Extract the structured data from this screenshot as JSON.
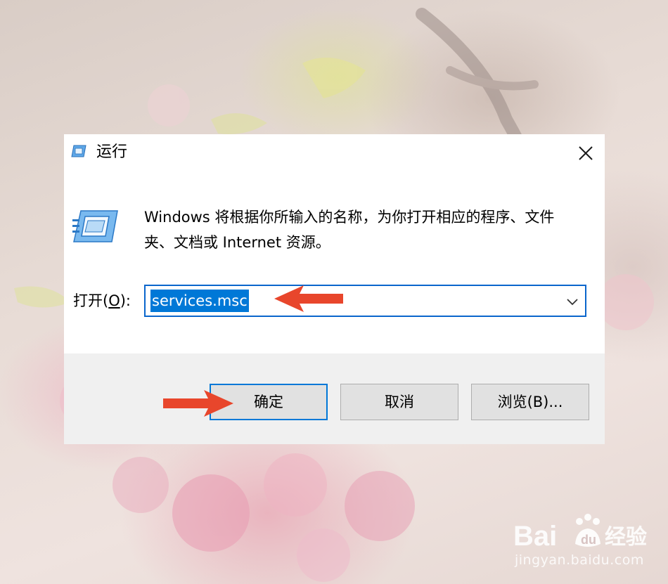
{
  "dialog": {
    "title": "运行",
    "description": "Windows 将根据你所输入的名称，为你打开相应的程序、文件夹、文档或 Internet 资源。",
    "open_label_prefix": "打开(",
    "open_label_key": "O",
    "open_label_suffix": "):",
    "input_value": "services.msc",
    "buttons": {
      "ok": "确定",
      "cancel": "取消",
      "browse": "浏览(B)..."
    }
  },
  "watermark": {
    "logo_text": "Bai du 经验",
    "url": "jingyan.baidu.com"
  },
  "colors": {
    "accent": "#0078d7",
    "annotation_arrow": "#e8462c"
  }
}
